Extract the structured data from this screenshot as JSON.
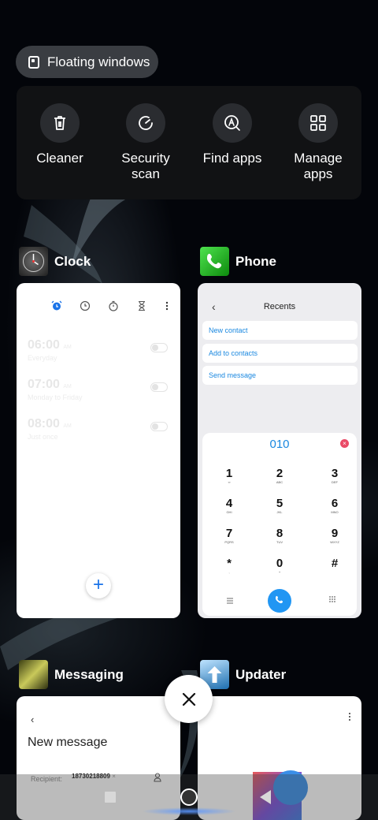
{
  "floating_windows": {
    "label": "Floating windows",
    "icon": "floating-window-icon"
  },
  "tools": [
    {
      "label": "Cleaner",
      "icon": "trash-icon"
    },
    {
      "label": "Security\nscan",
      "icon": "shield-scan-icon"
    },
    {
      "label": "Find apps",
      "icon": "find-apps-icon"
    },
    {
      "label": "Manage\napps",
      "icon": "grid-icon"
    }
  ],
  "apps": {
    "clock": {
      "name": "Clock",
      "alarms": [
        {
          "time": "06:00",
          "ampm": "AM",
          "repeat": "Everyday"
        },
        {
          "time": "07:00",
          "ampm": "AM",
          "repeat": "Monday to Friday"
        },
        {
          "time": "08:00",
          "ampm": "AM",
          "repeat": "Just once"
        }
      ]
    },
    "phone": {
      "name": "Phone",
      "title": "Recents",
      "options": [
        "New contact",
        "Add to contacts",
        "Send message"
      ],
      "dialed": "010",
      "keys": [
        {
          "d": "1",
          "l": "∞"
        },
        {
          "d": "2",
          "l": "ABC"
        },
        {
          "d": "3",
          "l": "DEF"
        },
        {
          "d": "4",
          "l": "GHI"
        },
        {
          "d": "5",
          "l": "JKL"
        },
        {
          "d": "6",
          "l": "MNO"
        },
        {
          "d": "7",
          "l": "PQRS"
        },
        {
          "d": "8",
          "l": "TUV"
        },
        {
          "d": "9",
          "l": "WXYZ"
        },
        {
          "d": "*",
          "l": ","
        },
        {
          "d": "0",
          "l": "+"
        },
        {
          "d": "#",
          "l": ""
        }
      ]
    },
    "messaging": {
      "name": "Messaging",
      "title": "New message",
      "recipient_label": "Recipient:",
      "recipient": "18730218809"
    },
    "updater": {
      "name": "Updater"
    }
  },
  "colors": {
    "accent": "#2196f3",
    "phone_icon": "#1fb31f",
    "updater_icon": "#1e6fb0"
  }
}
